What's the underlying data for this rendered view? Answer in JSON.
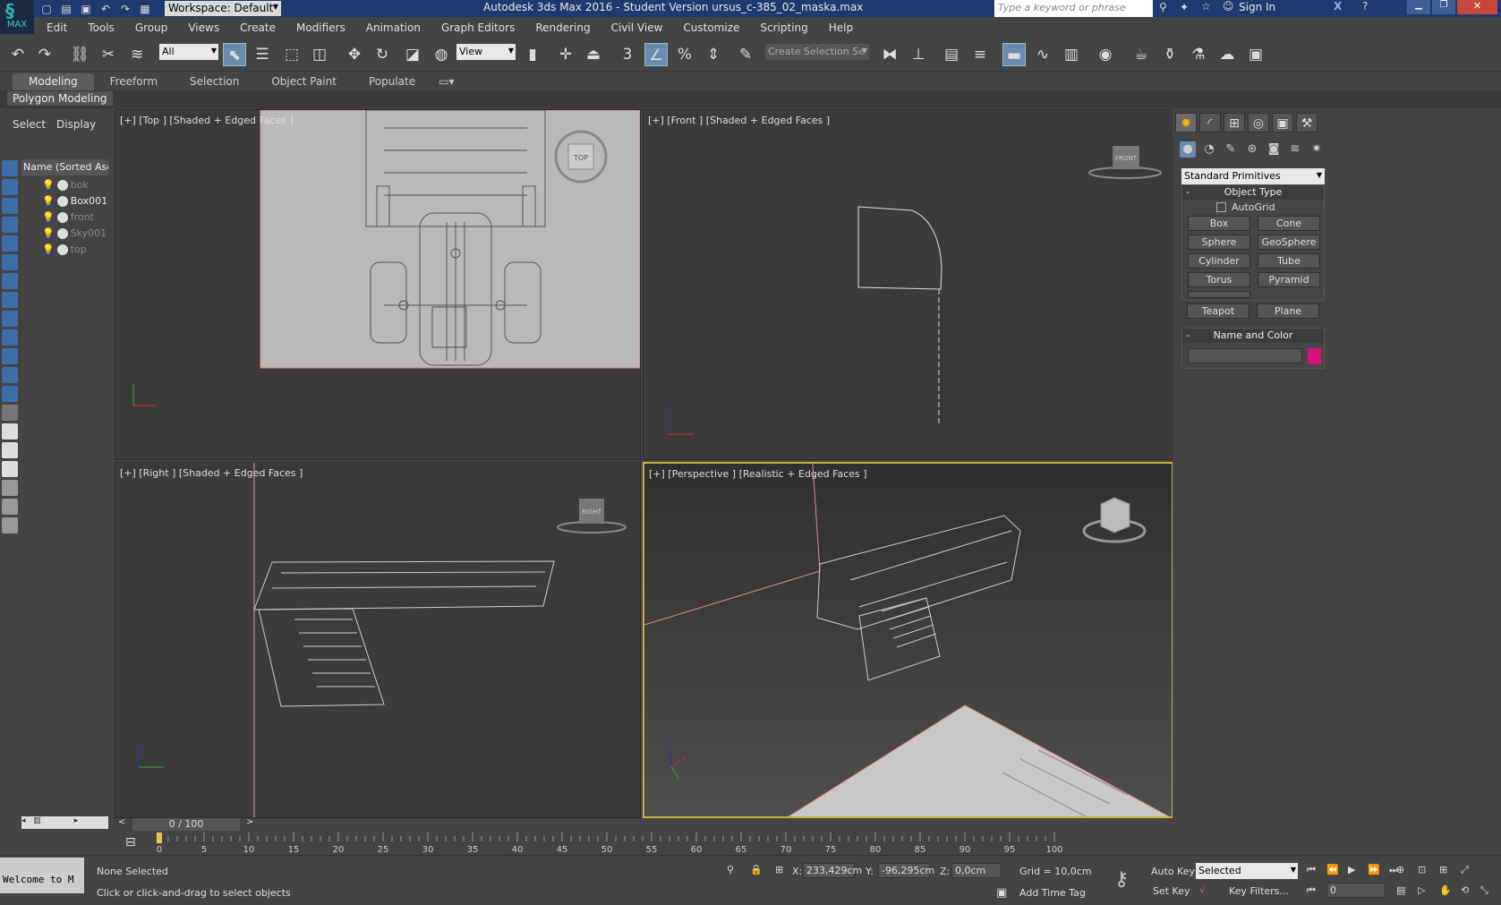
{
  "app": {
    "title": "Autodesk 3ds Max 2016 - Student Version    ursus_c-385_02_maska.max",
    "logo_text": "MAX",
    "workspace": "Workspace: Default",
    "search_placeholder": "Type a keyword or phrase",
    "sign_in": "Sign In"
  },
  "menu": [
    "Edit",
    "Tools",
    "Group",
    "Views",
    "Create",
    "Modifiers",
    "Animation",
    "Graph Editors",
    "Rendering",
    "Civil View",
    "Customize",
    "Scripting",
    "Help"
  ],
  "toolbar": {
    "filter": "All",
    "ref_coord": "View",
    "selection_set": "Create Selection Se",
    "snap_num": "3"
  },
  "ribbon": {
    "tabs": [
      "Modeling",
      "Freeform",
      "Selection",
      "Object Paint",
      "Populate"
    ],
    "panel": "Polygon Modeling"
  },
  "explorer": {
    "tabs": [
      "Select",
      "Display"
    ],
    "column": "Name (Sorted Ascen",
    "objects": [
      "bok",
      "Box001",
      "front",
      "Sky001",
      "top"
    ]
  },
  "viewports": {
    "top": "[+] [Top ] [Shaded + Edged Faces ]",
    "front": "[+] [Front ] [Shaded + Edged Faces ]",
    "right": "[+] [Right ] [Shaded + Edged Faces ]",
    "perspective": "[+] [Perspective ] [Realistic + Edged Faces ]",
    "cube_top": "TOP",
    "cube_front": "FRONT",
    "cube_right": "RIGHT"
  },
  "command_panel": {
    "primitive_type": "Standard Primitives",
    "object_type_title": "Object Type",
    "autogrid": "AutoGrid",
    "buttons": [
      "Box",
      "Cone",
      "Sphere",
      "GeoSphere",
      "Cylinder",
      "Tube",
      "Torus",
      "Pyramid",
      "Teapot",
      "Plane"
    ],
    "name_color_title": "Name and Color",
    "color": "#d6127a"
  },
  "timeline": {
    "frame": "0 / 100",
    "ticks": [
      "0",
      "5",
      "10",
      "15",
      "20",
      "25",
      "30",
      "35",
      "40",
      "45",
      "50",
      "55",
      "60",
      "65",
      "70",
      "75",
      "80",
      "85",
      "90",
      "95",
      "100"
    ]
  },
  "status": {
    "welcome": "Welcome to M",
    "selection": "None Selected",
    "prompt": "Click or click-and-drag to select objects",
    "x_label": "X:",
    "x": "233,429cm",
    "y_label": "Y:",
    "y": "-96,295cm",
    "z_label": "Z:",
    "z": "0,0cm",
    "grid": "Grid = 10,0cm",
    "add_time_tag": "Add Time Tag",
    "auto_key": "Auto Key",
    "set_key": "Set Key",
    "key_mode": "Selected",
    "key_filters": "Key Filters...",
    "frame_field": "0"
  }
}
